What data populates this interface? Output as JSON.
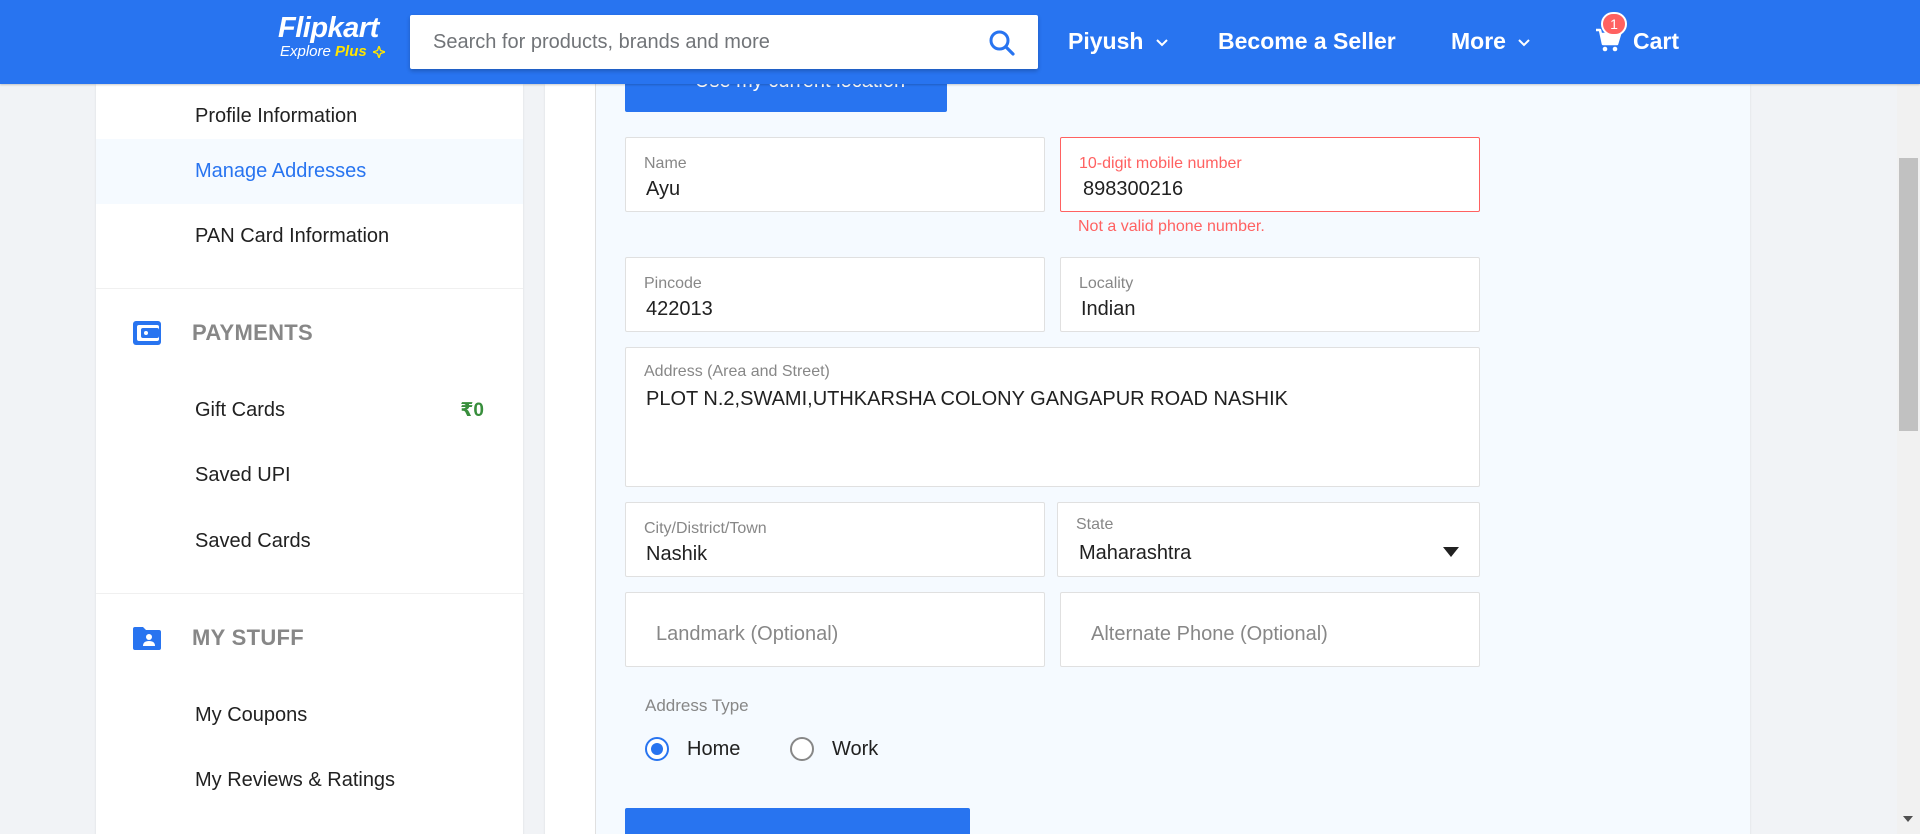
{
  "header": {
    "logo_brand": "Flipkart",
    "logo_explore": "Explore",
    "logo_plus": "Plus",
    "search_placeholder": "Search for products, brands and more",
    "user_label": "Piyush",
    "seller_label": "Become a Seller",
    "more_label": "More",
    "cart_label": "Cart",
    "cart_count": "1"
  },
  "sidebar": {
    "account_items": [
      {
        "label": "Profile Information"
      },
      {
        "label": "Manage Addresses"
      },
      {
        "label": "PAN Card Information"
      }
    ],
    "payments_title": "PAYMENTS",
    "payments_items": [
      {
        "label": "Gift Cards",
        "amount": "₹0"
      },
      {
        "label": "Saved UPI"
      },
      {
        "label": "Saved Cards"
      }
    ],
    "mystuff_title": "MY STUFF",
    "mystuff_items": [
      {
        "label": "My Coupons"
      },
      {
        "label": "My Reviews & Ratings"
      }
    ]
  },
  "form": {
    "location_button": "Use my current location",
    "name": {
      "label": "Name",
      "value": "Ayu"
    },
    "mobile": {
      "label": "10-digit mobile number",
      "value": "898300216",
      "error": "Not a valid phone number."
    },
    "pincode": {
      "label": "Pincode",
      "value": "422013"
    },
    "locality": {
      "label": "Locality",
      "value": "Indian"
    },
    "address": {
      "label": "Address (Area and Street)",
      "value": "PLOT N.2,SWAMI,UTHKARSHA COLONY GANGAPUR ROAD NASHIK"
    },
    "city": {
      "label": "City/District/Town",
      "value": "Nashik"
    },
    "state": {
      "label": "State",
      "value": "Maharashtra"
    },
    "landmark_placeholder": "Landmark (Optional)",
    "alt_phone_placeholder": "Alternate Phone (Optional)",
    "address_type_label": "Address Type",
    "address_type_options": [
      "Home",
      "Work"
    ],
    "address_type_selected": "Home"
  },
  "colors": {
    "brand": "#2874f0",
    "error": "#ff6161",
    "success": "#388e3c",
    "plus_yellow": "#ffe500"
  }
}
